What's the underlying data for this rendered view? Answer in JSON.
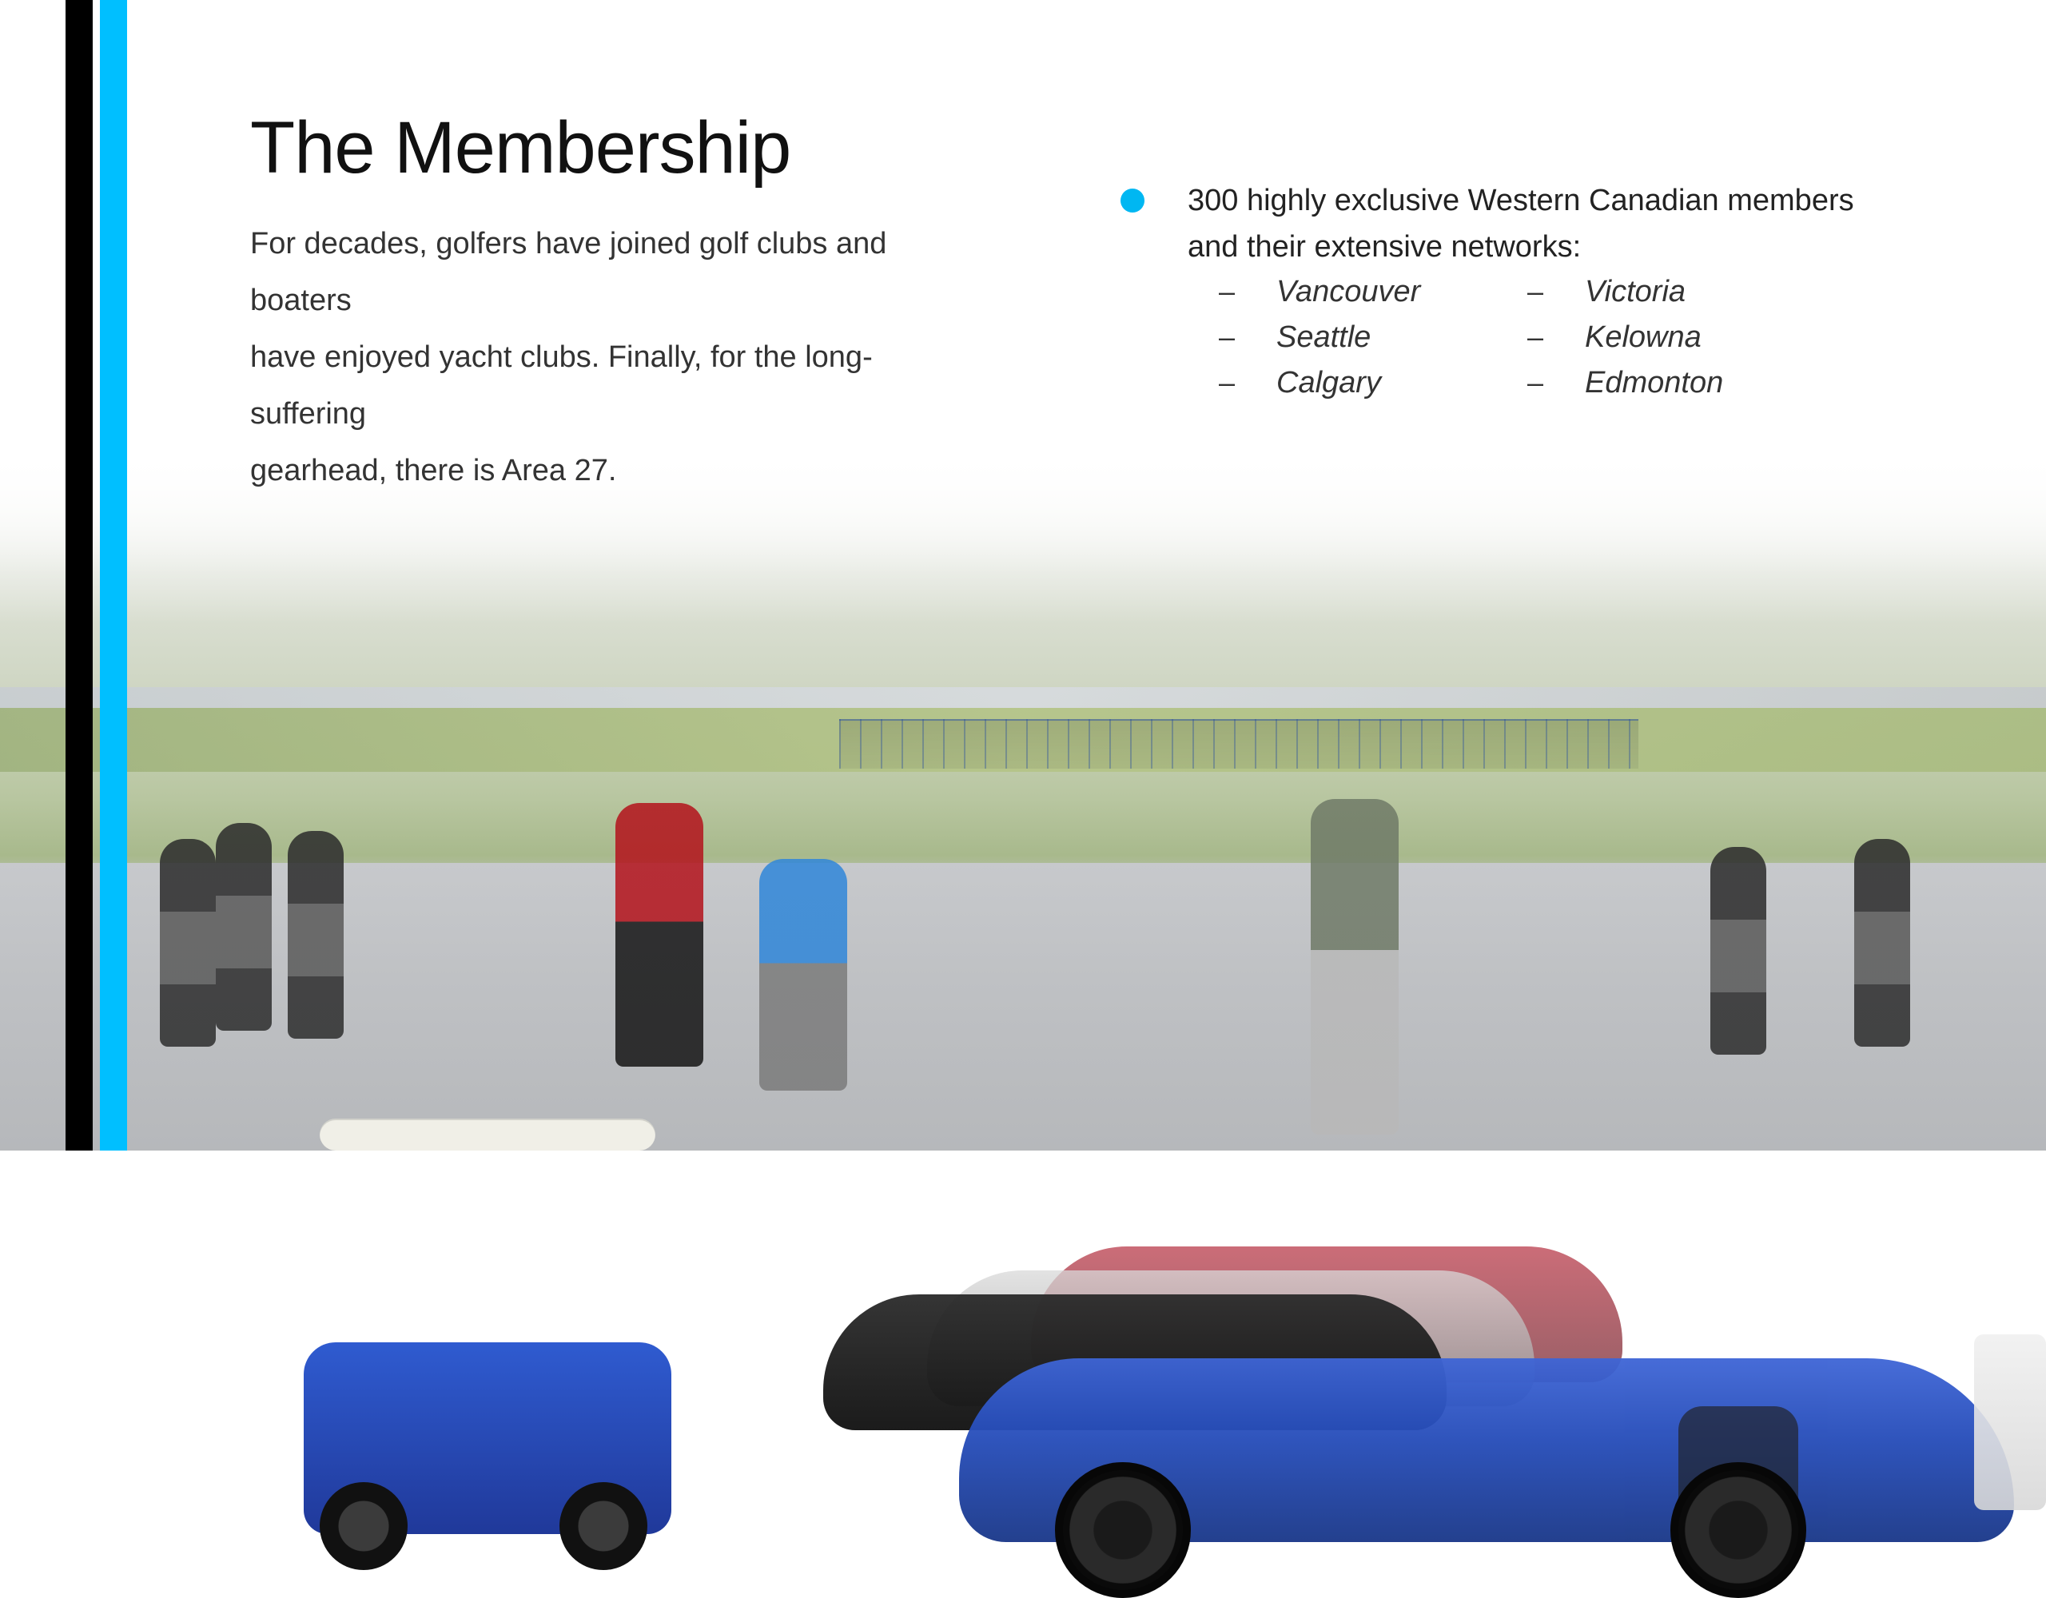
{
  "slide": {
    "title": "The Membership",
    "intro_lines": [
      "For decades, golfers have joined golf clubs and boaters",
      "have enjoyed yacht clubs. Finally, for the long-suffering",
      "gearhead, there is Area 27."
    ],
    "bullet": {
      "lines": [
        "300 highly exclusive Western Canadian members",
        "and their extensive networks:"
      ],
      "dash_glyph": "–",
      "cities_left": [
        "Vancouver",
        "Seattle",
        "Calgary"
      ],
      "cities_right": [
        "Victoria",
        "Kelowna",
        "Edmonton"
      ]
    }
  },
  "colors": {
    "stripe_black": "#000000",
    "stripe_cyan": "#00bfff",
    "bullet": "#00b7f2",
    "cart_blue": "#2f5bd0",
    "car_blue": "#244bb8",
    "staff_shirt_red": "#b3121b"
  }
}
